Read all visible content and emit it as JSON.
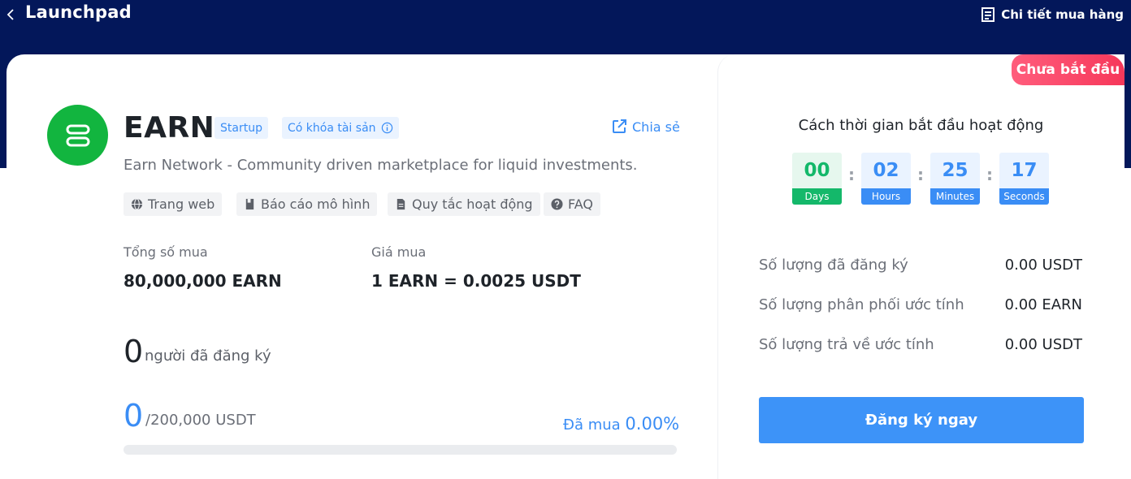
{
  "header": {
    "title": "Launchpad",
    "back_icon": "chevron-left-icon",
    "order_link": "Chi tiết mua hàng",
    "order_icon": "document-icon"
  },
  "project": {
    "token": "EARN",
    "logo_icon": "earn-logo",
    "logo_color": "#12b53f",
    "tags": [
      "Startup",
      "Có khóa tài sản"
    ],
    "share_label": "Chia sẻ",
    "description": "Earn Network - Community driven marketplace for liquid investments.",
    "links": [
      "Trang web",
      "Báo cáo mô hình",
      "Quy tắc hoạt động",
      "FAQ"
    ],
    "status": "Chưa bắt đầu"
  },
  "stats": {
    "total_label": "Tổng số mua",
    "total_value": "80,000,000 EARN",
    "price_label": "Giá mua",
    "price_value": "1 EARN = 0.0025 USDT"
  },
  "subscribers": {
    "count": "0",
    "label": "người đã đăng ký"
  },
  "progress": {
    "raised": "0",
    "target": "/200,000 USDT",
    "bought_label": "Đã mua",
    "bought_pct": "0.00%",
    "fraction": 0
  },
  "countdown": {
    "title": "Cách thời gian bắt đầu hoạt động",
    "days": "00",
    "days_label": "Days",
    "hours": "02",
    "hours_label": "Hours",
    "minutes": "25",
    "minutes_label": "Minutes",
    "seconds": "17",
    "seconds_label": "Seconds"
  },
  "info": [
    {
      "label": "Số lượng đã đăng ký",
      "value": "0.00 USDT"
    },
    {
      "label": "Số lượng phân phối ước tính",
      "value": "0.00 EARN"
    },
    {
      "label": "Số lượng trả về ước tính",
      "value": "0.00 USDT"
    }
  ],
  "action": {
    "register_label": "Đăng ký ngay"
  },
  "colors": {
    "header_bg": "#03175a",
    "accent": "#3a8df5",
    "badge": "#f6375a",
    "days": "#14b86a"
  }
}
